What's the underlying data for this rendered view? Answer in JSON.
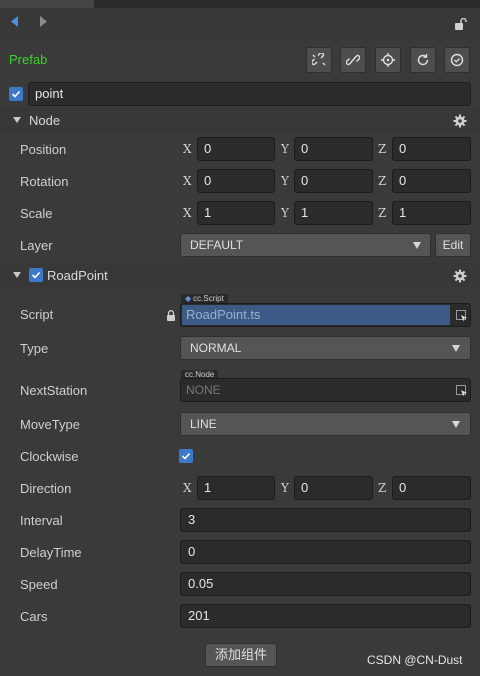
{
  "header": {
    "prefab_label": "Prefab"
  },
  "node": {
    "name": "point",
    "section_title": "Node",
    "position": {
      "label": "Position",
      "x": "0",
      "y": "0",
      "z": "0"
    },
    "rotation": {
      "label": "Rotation",
      "x": "0",
      "y": "0",
      "z": "0"
    },
    "scale": {
      "label": "Scale",
      "x": "1",
      "y": "1",
      "z": "1"
    },
    "layer": {
      "label": "Layer",
      "value": "DEFAULT",
      "edit_label": "Edit"
    }
  },
  "axes": {
    "x": "X",
    "y": "Y",
    "z": "Z"
  },
  "roadpoint": {
    "section_title": "RoadPoint",
    "script": {
      "label": "Script",
      "tag": "cc.Script",
      "value": "RoadPoint.ts"
    },
    "type": {
      "label": "Type",
      "value": "NORMAL"
    },
    "next_station": {
      "label": "NextStation",
      "tag": "cc.Node",
      "value": "NONE"
    },
    "move_type": {
      "label": "MoveType",
      "value": "LINE"
    },
    "clockwise": {
      "label": "Clockwise",
      "checked": true
    },
    "direction": {
      "label": "Direction",
      "x": "1",
      "y": "0",
      "z": "0"
    },
    "interval": {
      "label": "Interval",
      "value": "3"
    },
    "delay_time": {
      "label": "DelayTime",
      "value": "0"
    },
    "speed": {
      "label": "Speed",
      "value": "0.05"
    },
    "cars": {
      "label": "Cars",
      "value": "201"
    }
  },
  "footer": {
    "add_component_label": "添加组件",
    "watermark": "CSDN @CN-Dust"
  },
  "colors": {
    "prefab_green": "#3cd22b",
    "checkbox_blue": "#3d79c9",
    "panel_bg": "#3a3a3a",
    "input_bg": "#2b2b2b",
    "select_bg": "#555555",
    "script_highlight": "#3b5a86"
  }
}
